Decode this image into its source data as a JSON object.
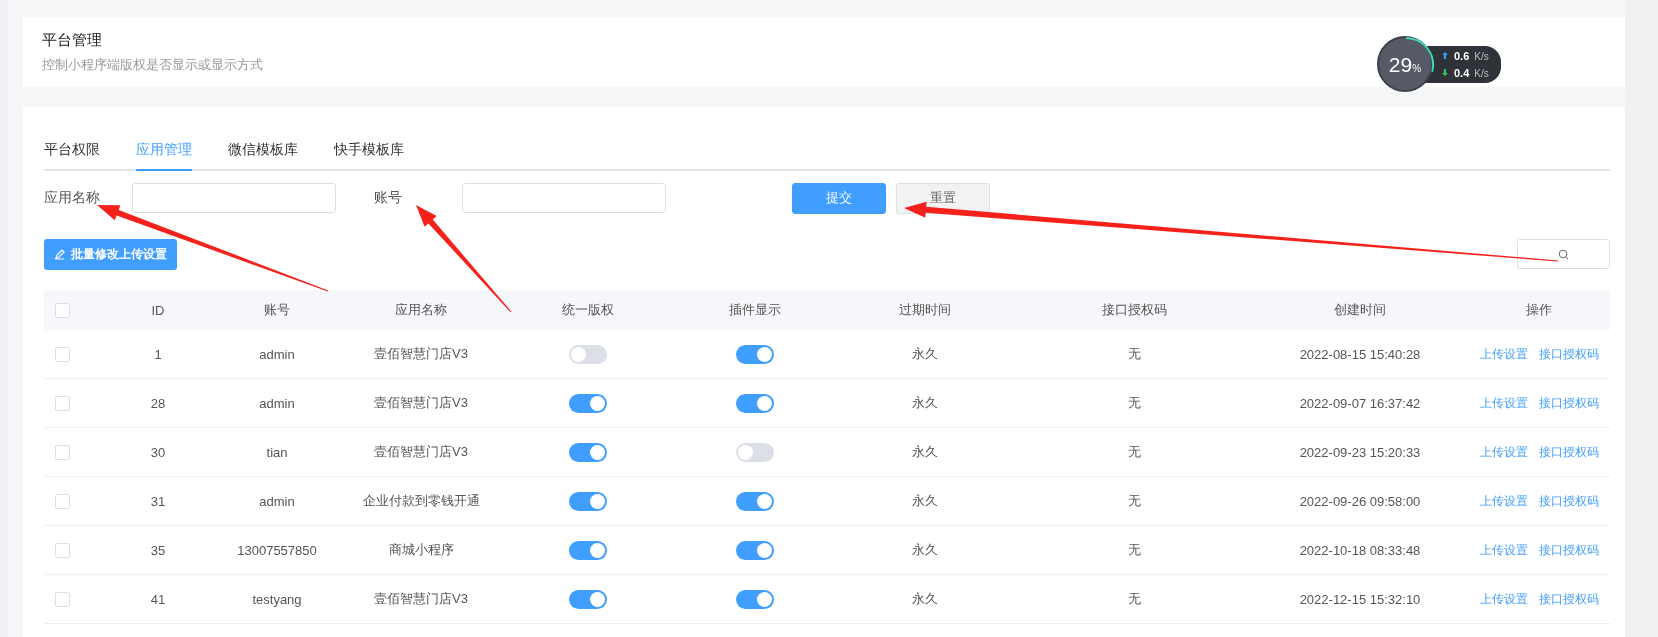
{
  "header": {
    "title": "平台管理",
    "subtitle": "控制小程序端版权是否显示或显示方式"
  },
  "tabs": [
    {
      "label": "平台权限",
      "selected": false
    },
    {
      "label": "应用管理",
      "selected": true
    },
    {
      "label": "微信模板库",
      "selected": false
    },
    {
      "label": "快手模板库",
      "selected": false
    }
  ],
  "filters": [
    {
      "label": "应用名称"
    },
    {
      "label": "账号"
    }
  ],
  "buttons": [
    {
      "label": "提交",
      "kind": "primary"
    },
    {
      "label": "重置",
      "kind": "plain"
    }
  ],
  "batch_button": "批量修改上传设置",
  "table": {
    "select_all_checked": false,
    "columns": [
      "ID",
      "账号",
      "应用名称",
      "统一版权",
      "插件显示",
      "过期时间",
      "接口授权码",
      "创建时间",
      "操作"
    ],
    "rows": [
      {
        "checked": false,
        "id": "1",
        "account": "admin",
        "app": "壹佰智慧门店V3",
        "copyright_on": false,
        "plugin_on": true,
        "expiry": "永久",
        "auth_code": "无",
        "created": "2022-08-15 15:40:28",
        "actions": [
          "上传设置",
          "接口授权码"
        ]
      },
      {
        "checked": false,
        "id": "28",
        "account": "admin",
        "app": "壹佰智慧门店V3",
        "copyright_on": true,
        "plugin_on": true,
        "expiry": "永久",
        "auth_code": "无",
        "created": "2022-09-07 16:37:42",
        "actions": [
          "上传设置",
          "接口授权码"
        ]
      },
      {
        "checked": false,
        "id": "30",
        "account": "tian",
        "app": "壹佰智慧门店V3",
        "copyright_on": true,
        "plugin_on": false,
        "expiry": "永久",
        "auth_code": "无",
        "created": "2022-09-23 15:20:33",
        "actions": [
          "上传设置",
          "接口授权码"
        ]
      },
      {
        "checked": false,
        "id": "31",
        "account": "admin",
        "app": "企业付款到零钱开通",
        "copyright_on": true,
        "plugin_on": true,
        "expiry": "永久",
        "auth_code": "无",
        "created": "2022-09-26 09:58:00",
        "actions": [
          "上传设置",
          "接口授权码"
        ]
      },
      {
        "checked": false,
        "id": "35",
        "account": "13007557850",
        "app": "商城小程序",
        "copyright_on": true,
        "plugin_on": true,
        "expiry": "永久",
        "auth_code": "无",
        "created": "2022-10-18 08:33:48",
        "actions": [
          "上传设置",
          "接口授权码"
        ]
      },
      {
        "checked": false,
        "id": "41",
        "account": "testyang",
        "app": "壹佰智慧门店V3",
        "copyright_on": true,
        "plugin_on": true,
        "expiry": "永久",
        "auth_code": "无",
        "created": "2022-12-15 15:32:10",
        "actions": [
          "上传设置",
          "接口授权码"
        ]
      }
    ]
  },
  "speed_widget": {
    "percent": "29",
    "percent_unit": "%",
    "upload": "0.6",
    "upload_unit": "K/s",
    "download": "0.4",
    "download_unit": "K/s"
  }
}
